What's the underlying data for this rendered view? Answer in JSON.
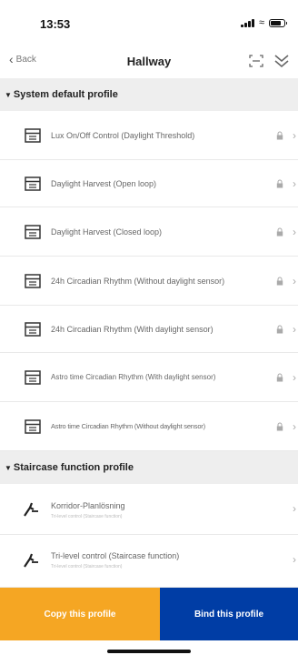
{
  "status_bar": {
    "time": "13:53",
    "icons": [
      "signal-icon",
      "wifi-icon",
      "battery-icon"
    ]
  },
  "nav": {
    "back_label": "Back",
    "title": "Hallway",
    "icons": [
      "scan-icon",
      "double-chevron-down-icon"
    ]
  },
  "sections": [
    {
      "title": "System default profile",
      "items": [
        {
          "label": "Lux On/Off Control (Daylight Threshold)",
          "locked": true
        },
        {
          "label": "Daylight Harvest (Open loop)",
          "locked": true
        },
        {
          "label": "Daylight Harvest (Closed loop)",
          "locked": true
        },
        {
          "label": "24h Circadian Rhythm (Without daylight sensor)",
          "locked": true
        },
        {
          "label": "24h Circadian Rhythm (With daylight sensor)",
          "locked": true
        },
        {
          "label": "Astro time Circadian Rhythm (With daylight sensor)",
          "locked": true
        },
        {
          "label": "Astro time Circadian Rhythm (Without daylight sensor)",
          "locked": true
        }
      ]
    },
    {
      "title": "Staircase function profile",
      "items": [
        {
          "label": "Korridor-Planlösning",
          "sublabel": "Tri-level control (Staircase function)"
        },
        {
          "label": "Tri-level control (Staircase function)",
          "sublabel": "Tri-level control (Staircase function)"
        }
      ]
    }
  ],
  "actions": {
    "copy_label": "Copy this profile",
    "bind_label": "Bind this profile"
  },
  "colors": {
    "copy_button": "#f5a623",
    "bind_button": "#003da5",
    "section_background": "#eeeeee"
  },
  "battery_level": 0.8
}
